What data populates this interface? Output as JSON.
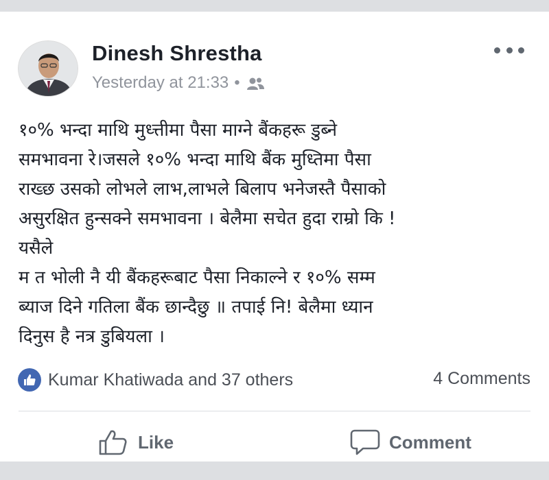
{
  "post": {
    "author": "Dinesh Shrestha",
    "timestamp": "Yesterday at 21:33",
    "separator": "•",
    "audience_icon": "friends-icon",
    "more_icon": "more-options-icon",
    "text_lines": [
      "१०% भन्दा माथि मुध्त्तीमा  पैसा माग्ने बैंकहरू डुब्ने",
      "समभावना रे।जसले १०% भन्दा माथि बैंक मुध्तिमा पैसा",
      "राख्छ  उसको लोभले लाभ,लाभले बिलाप भनेजस्तै पैसाको",
      "असुरक्षित हुन्सक्ने समभावना । बेलैमा सचेत हुदा राम्रो कि !",
      "यसैले",
      "म त भोली नै यी बैंकहरूबाट पैसा निकाल्ने र १०% सम्म",
      "ब्याज दिने गतिला बैंक छान्दैछु ॥ तपाई नि! बेलैमा ध्यान",
      "दिनुस है नत्र डुबियला ।"
    ]
  },
  "reactions": {
    "text": "Kumar Khatiwada and 37 others",
    "icon": "like-reaction-icon",
    "comments": "4 Comments"
  },
  "actions": {
    "like_label": "Like",
    "comment_label": "Comment"
  },
  "colors": {
    "accent": "#4267b2",
    "text": "#1d2129",
    "meta": "#90949c",
    "background": "#dddfe2"
  }
}
